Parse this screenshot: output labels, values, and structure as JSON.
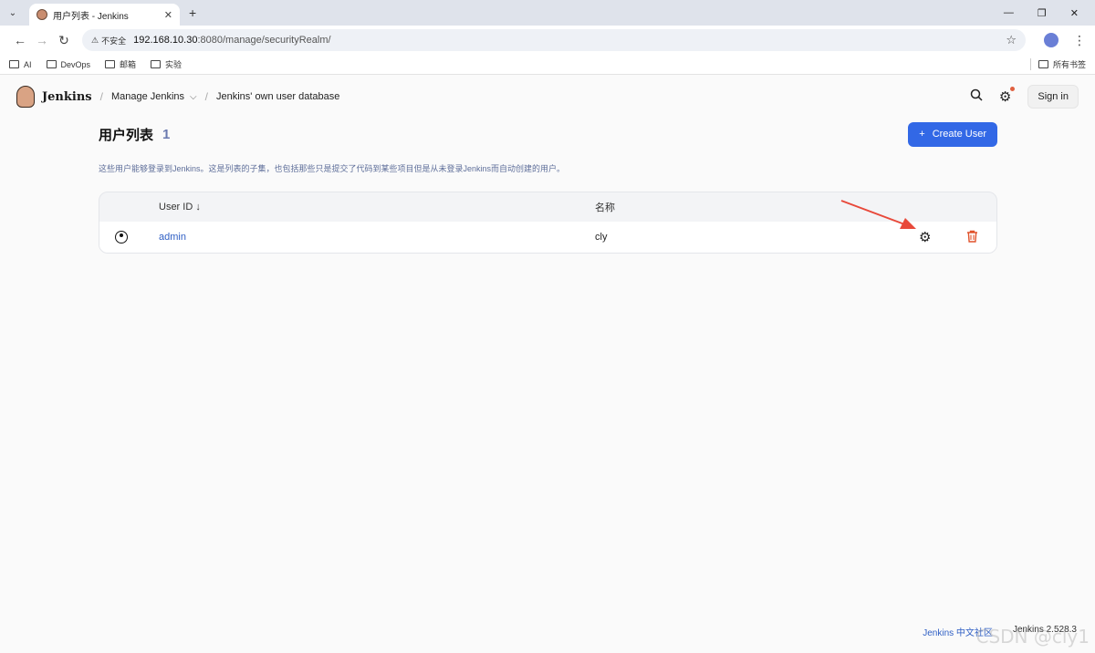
{
  "browser": {
    "tab_title": "用户列表 - Jenkins",
    "insecure_label": "不安全",
    "url_host": "192.168.10.30",
    "url_path": ":8080/manage/securityRealm/",
    "bookmarks": [
      "AI",
      "DevOps",
      "邮箱",
      "实验"
    ],
    "bookmarks_all": "所有书签"
  },
  "header": {
    "brand": "Jenkins",
    "breadcrumb": [
      "Manage Jenkins",
      "Jenkins' own user database"
    ],
    "signin_label": "Sign in"
  },
  "page": {
    "title": "用户列表",
    "count": "1",
    "create_label": "Create User",
    "description": "这些用户能够登录到Jenkins。这是列表的子集，也包括那些只是提交了代码到某些项目但是从未登录Jenkins而自动创建的用户。"
  },
  "table": {
    "columns": {
      "user_id": "User ID",
      "sort_indicator": "↓",
      "name": "名称"
    },
    "rows": [
      {
        "user_id": "admin",
        "name": "cly"
      }
    ]
  },
  "footer": {
    "community": "Jenkins 中文社区",
    "version": "Jenkins 2.528.3"
  },
  "watermark": "CSDN @cly1",
  "colors": {
    "accent": "#3268e6",
    "link": "#2f5fc4",
    "delete": "#e0522b",
    "annotation_arrow": "#e8493a"
  }
}
